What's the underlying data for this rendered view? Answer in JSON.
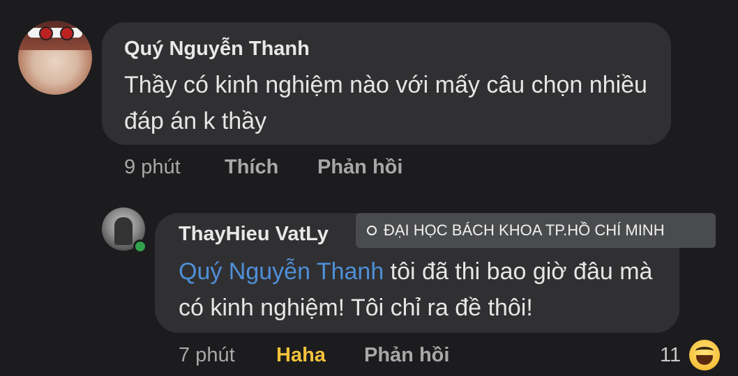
{
  "comments": [
    {
      "author": "Quý Nguyễn Thanh",
      "text": "Thầy có kinh nghiệm nào với mấy câu chọn nhiều đáp án k thầy",
      "time": "9 phút",
      "like_label": "Thích",
      "reply_label": "Phản hồi"
    }
  ],
  "reply": {
    "author": "ThayHieu VatLy",
    "location": "ĐẠI HỌC BÁCH KHOA TP.HỒ CHÍ MINH",
    "mention": "Quý Nguyễn Thanh",
    "text": " tôi đã thi bao giờ đâu mà có kinh nghiệm! Tôi chỉ ra đề thôi!",
    "time": "7 phút",
    "reaction_label": "Haha",
    "reply_label": "Phản hồi",
    "reaction_count": "11",
    "reaction_icon": "laughing-emoji-icon"
  },
  "colors": {
    "background": "#1c1c1e",
    "bubble": "#303032",
    "mention": "#4f8fd8",
    "haha": "#f5c33b",
    "online": "#31a24c"
  }
}
